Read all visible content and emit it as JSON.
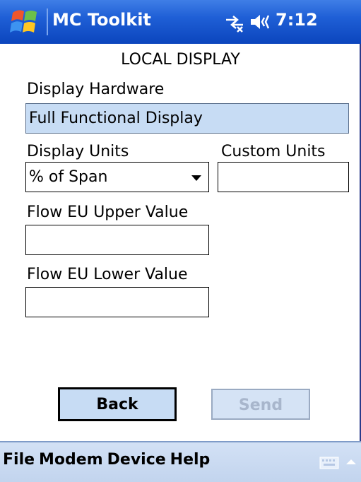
{
  "titlebar": {
    "app_title": "MC Toolkit",
    "time": "7:12",
    "icons": [
      "windows-start-icon",
      "connectivity-icon",
      "volume-icon"
    ]
  },
  "page": {
    "title": "LOCAL DISPLAY",
    "display_hardware": {
      "label": "Display Hardware",
      "value": "Full Functional Display"
    },
    "display_units": {
      "label": "Display Units",
      "value": "% of Span"
    },
    "custom_units": {
      "label": "Custom Units",
      "value": ""
    },
    "flow_eu_upper": {
      "label": "Flow EU Upper Value",
      "value": ""
    },
    "flow_eu_lower": {
      "label": "Flow EU Lower Value",
      "value": ""
    }
  },
  "buttons": {
    "back": "Back",
    "send": "Send"
  },
  "menubar": {
    "file": "File",
    "modem": "Modem",
    "device": "Device",
    "help": "Help"
  },
  "colors": {
    "titlebar": "#1f5fd6",
    "field_readonly": "#c7dcf4",
    "menubar": "#c2d4ee"
  }
}
